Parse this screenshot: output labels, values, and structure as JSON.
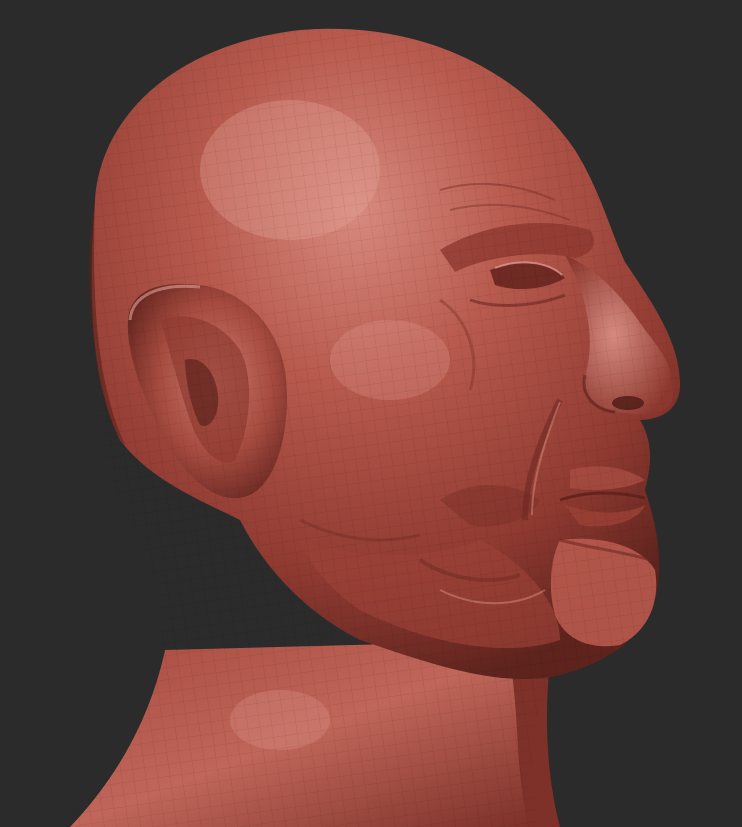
{
  "viewport": {
    "background_color": "#2b2b2b"
  },
  "model": {
    "material": "red-wax clay",
    "base_color": "#b55449",
    "shadow_color": "#6e2c25",
    "highlight_color": "#e8a398",
    "wireframe_visible": true
  }
}
